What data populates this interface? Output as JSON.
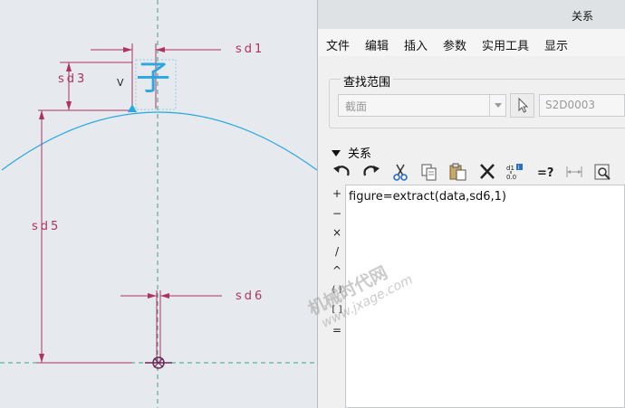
{
  "window": {
    "title": "关系"
  },
  "menu": [
    "文件",
    "编辑",
    "插入",
    "参数",
    "实用工具",
    "显示"
  ],
  "scope": {
    "label": "查找范围",
    "combo_value": "截面",
    "sketch_name": "S2D0003"
  },
  "relations": {
    "header": "关系",
    "operators": [
      "+",
      "−",
      "×",
      "/",
      "^",
      "( )",
      "[ ]",
      "="
    ],
    "lines": [
      "figure=extract(data,sd6,1)"
    ]
  },
  "toolbar_icons": [
    "undo-icon",
    "redo-icon",
    "cut-icon",
    "copy-icon",
    "paste-icon",
    "delete-icon",
    "switch-dimensions-icon",
    "evaluate-icon",
    "insert-dimension-icon",
    "sort-relations-icon"
  ],
  "sketch": {
    "dims": [
      "sd1",
      "sd3",
      "sd5",
      "sd6"
    ],
    "symbol": "V",
    "glyph": "子"
  },
  "watermark": {
    "text": "机械时代网",
    "url": "www.jxage.com"
  },
  "colors": {
    "dim": "#b0335f",
    "curve": "#2aa7e0",
    "centerline": "#3aa08a"
  }
}
